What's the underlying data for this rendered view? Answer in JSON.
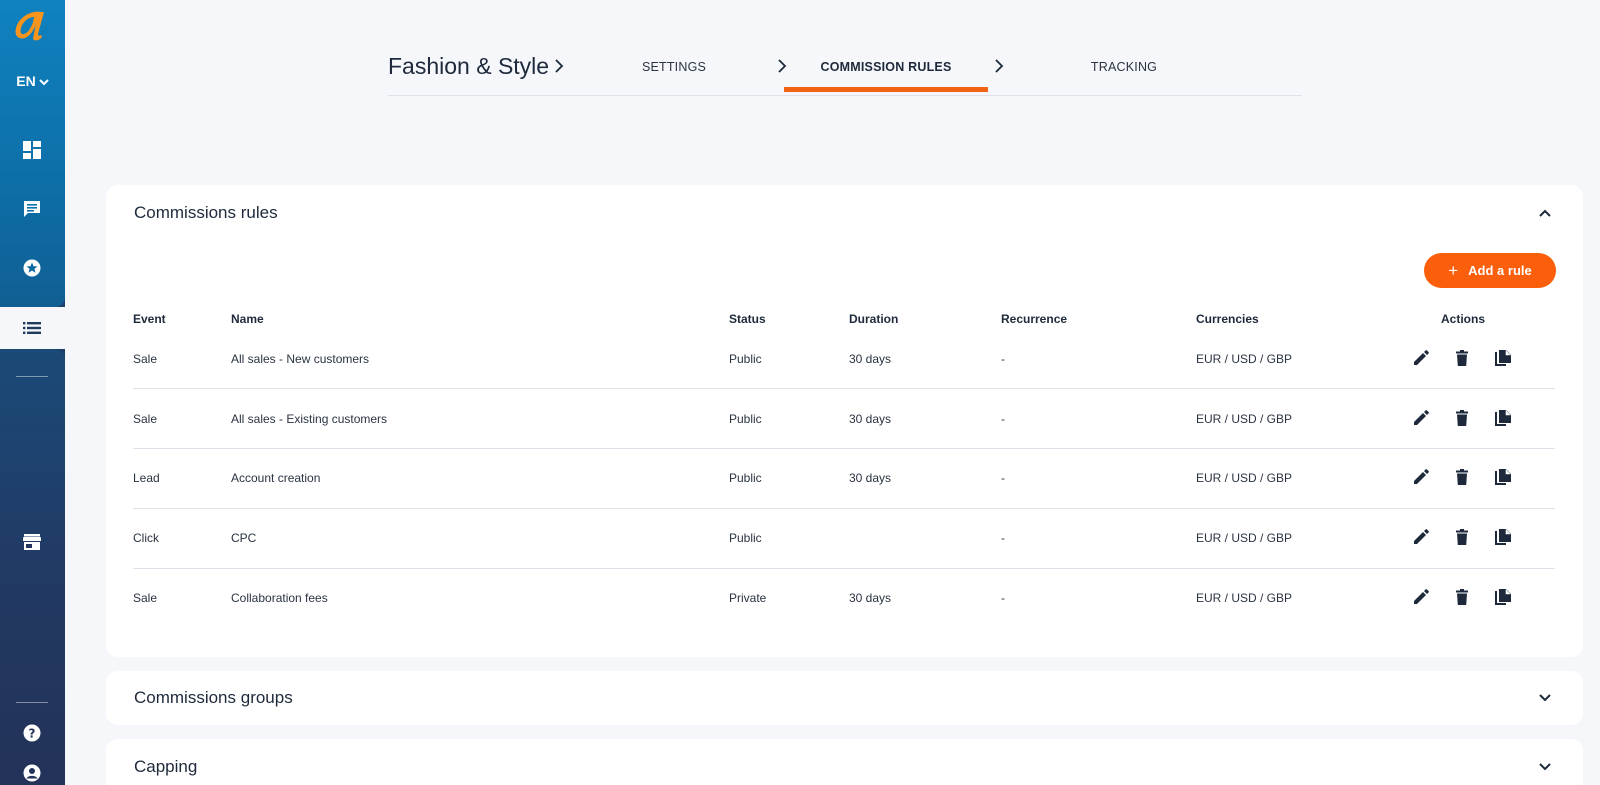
{
  "sidebar": {
    "language": "EN",
    "icons": [
      "logo",
      "dashboard-icon",
      "chat-icon",
      "star-badge-icon",
      "list-icon",
      "store-icon",
      "help-icon",
      "account-icon"
    ]
  },
  "stepper": {
    "title": "Fashion & Style",
    "steps": [
      {
        "label": "SETTINGS",
        "active": false
      },
      {
        "label": "COMMISSION RULES",
        "active": true
      },
      {
        "label": "TRACKING",
        "active": false
      }
    ]
  },
  "colors": {
    "accent": "#fb5f0c",
    "sidebar_top": "#0f82c0",
    "sidebar_bottom": "#233258",
    "text": "#1e2a3b"
  },
  "commission_rules": {
    "title": "Commissions rules",
    "add_button": "Add a rule",
    "columns": [
      "Event",
      "Name",
      "Status",
      "Duration",
      "Recurrence",
      "Currencies",
      "Actions"
    ],
    "rows": [
      {
        "event": "Sale",
        "name": "All sales - New customers",
        "status": "Public",
        "duration": "30 days",
        "recurrence": "-",
        "currencies": "EUR / USD / GBP"
      },
      {
        "event": "Sale",
        "name": "All sales - Existing customers",
        "status": "Public",
        "duration": "30 days",
        "recurrence": "-",
        "currencies": "EUR / USD / GBP"
      },
      {
        "event": "Lead",
        "name": "Account creation",
        "status": "Public",
        "duration": "30 days",
        "recurrence": "-",
        "currencies": "EUR / USD / GBP"
      },
      {
        "event": "Click",
        "name": "CPC",
        "status": "Public",
        "duration": "",
        "recurrence": "-",
        "currencies": "EUR / USD / GBP"
      },
      {
        "event": "Sale",
        "name": "Collaboration fees",
        "status": "Private",
        "duration": "30 days",
        "recurrence": "-",
        "currencies": "EUR / USD / GBP"
      }
    ],
    "row_actions": [
      "edit-icon",
      "delete-icon",
      "duplicate-icon"
    ]
  },
  "commission_groups": {
    "title": "Commissions groups"
  },
  "capping": {
    "title": "Capping"
  }
}
